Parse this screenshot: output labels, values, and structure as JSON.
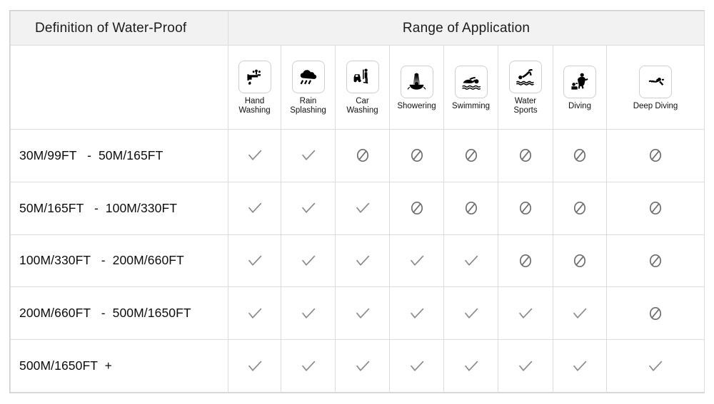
{
  "header": {
    "definition_title": "Definition of Water-Proof",
    "range_title": "Range of Application"
  },
  "columns": [
    {
      "id": "hand-washing",
      "label": "Hand\nWashing",
      "icon": "faucet-hand-washing-icon"
    },
    {
      "id": "rain-splashing",
      "label": "Rain\nSplashing",
      "icon": "rain-cloud-icon"
    },
    {
      "id": "car-washing",
      "label": "Car\nWashing",
      "icon": "car-washing-icon"
    },
    {
      "id": "showering",
      "label": "Showering",
      "icon": "shower-icon"
    },
    {
      "id": "swimming",
      "label": "Swimming",
      "icon": "swimmer-icon"
    },
    {
      "id": "water-sports",
      "label": "Water\nSports",
      "icon": "water-sports-dive-icon"
    },
    {
      "id": "diving",
      "label": "Diving",
      "icon": "scuba-diver-icon"
    },
    {
      "id": "deep-diving",
      "label": "Deep Diving",
      "icon": "deep-diver-icon"
    }
  ],
  "rows": [
    {
      "label": "30M/99FT   -  50M/165FT",
      "marks": [
        "check",
        "check",
        "no",
        "no",
        "no",
        "no",
        "no",
        "no"
      ]
    },
    {
      "label": "50M/165FT   -  100M/330FT",
      "marks": [
        "check",
        "check",
        "check",
        "no",
        "no",
        "no",
        "no",
        "no"
      ]
    },
    {
      "label": "100M/330FT   -  200M/660FT",
      "marks": [
        "check",
        "check",
        "check",
        "check",
        "check",
        "no",
        "no",
        "no"
      ]
    },
    {
      "label": "200M/660FT   -  500M/1650FT",
      "marks": [
        "check",
        "check",
        "check",
        "check",
        "check",
        "check",
        "check",
        "no"
      ]
    },
    {
      "label": "500M/1650FT  +",
      "marks": [
        "check",
        "check",
        "check",
        "check",
        "check",
        "check",
        "check",
        "check"
      ]
    }
  ],
  "marks": {
    "check": {
      "name": "check-mark-icon",
      "color": "#8a8a8a"
    },
    "no": {
      "name": "prohibited-icon",
      "color": "#6e6e6e"
    }
  },
  "colors": {
    "banner_background": "#f2f2f2",
    "grid_line": "#dcdcdc",
    "outer_border": "#d2d2d2",
    "text": "#1a1a1a"
  }
}
